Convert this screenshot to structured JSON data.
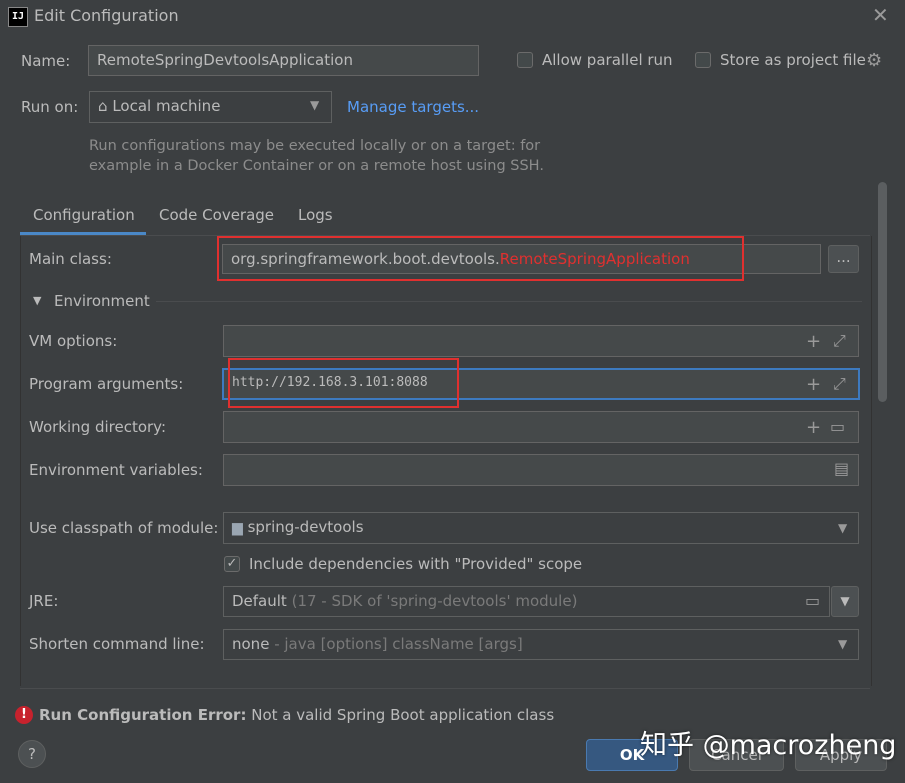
{
  "window": {
    "title": "Edit Configuration",
    "app_icon_text": "IJ"
  },
  "header": {
    "name_label": "Name:",
    "name_value": "RemoteSpringDevtoolsApplication",
    "allow_parallel_label": "Allow parallel run",
    "store_project_label": "Store as project file",
    "run_on_label": "Run on:",
    "run_on_value": "Local machine",
    "manage_targets": "Manage targets...",
    "hint_line1": "Run configurations may be executed locally or on a target: for",
    "hint_line2": "example in a Docker Container or on a remote host using SSH."
  },
  "tabs": [
    {
      "label": "Configuration",
      "active": true
    },
    {
      "label": "Code Coverage",
      "active": false
    },
    {
      "label": "Logs",
      "active": false
    }
  ],
  "config": {
    "main_class_label": "Main class:",
    "main_class_prefix": "org.springframework.boot.devtools.",
    "main_class_highlight": "RemoteSpringApplication",
    "browse_label": "...",
    "environment_section": "Environment",
    "vm_options_label": "VM options:",
    "vm_options_value": "",
    "program_args_label": "Program arguments:",
    "program_args_value": "http://192.168.3.101:8088",
    "working_dir_label": "Working directory:",
    "working_dir_value": "",
    "env_vars_label": "Environment variables:",
    "env_vars_value": "",
    "classpath_label": "Use classpath of module:",
    "classpath_value": "spring-devtools",
    "include_deps_label": "Include dependencies with \"Provided\" scope",
    "jre_label": "JRE:",
    "jre_value": "Default",
    "jre_detail": "(17 - SDK of 'spring-devtools' module)",
    "shorten_label": "Shorten command line:",
    "shorten_value": "none",
    "shorten_detail": "- java [options] className [args]"
  },
  "error": {
    "title": "Run Configuration Error:",
    "message": "Not a valid Spring Boot application class"
  },
  "footer": {
    "help": "?",
    "ok": "OK",
    "cancel": "Cancel",
    "apply": "Apply",
    "watermark": "知乎 @macrozheng"
  },
  "colors": {
    "accent": "#589df6",
    "error": "#e0302f",
    "highlight_text": "#e0302f",
    "background": "#3c3f41"
  }
}
